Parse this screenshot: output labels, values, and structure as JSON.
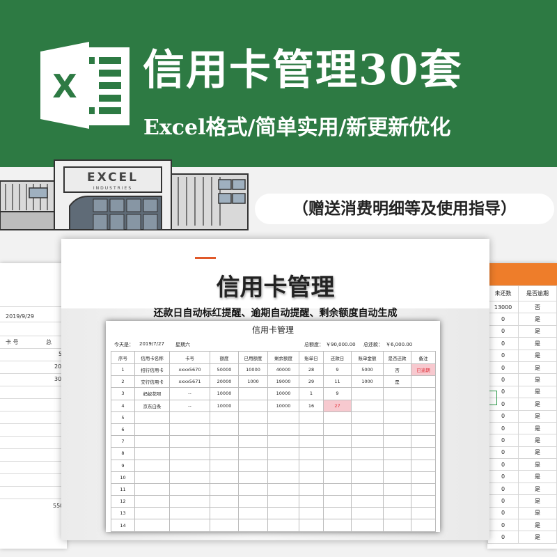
{
  "banner": {
    "title": "信用卡管理30套",
    "subtitle": "Excel格式/简单实用/新更新优化",
    "gift_note": "（赠送消费明细等及使用指导）",
    "logo_letter": "X",
    "building_sign": "EXCEL",
    "building_sign_sub": "INDUSTRIES"
  },
  "colors": {
    "banner_green": "#2d7a43",
    "accent_orange": "#ee7d2a",
    "overdue_pink": "#f7c9cf",
    "overdue_red": "#e0303a"
  },
  "left_sheet": {
    "date": "2019/9/29",
    "header": "卡  号",
    "header2": "总",
    "values": [
      "5",
      "20",
      "30"
    ],
    "total": "550"
  },
  "right_sheet": {
    "headers": [
      "未还数",
      "是否逾期"
    ],
    "rows": [
      [
        "13000",
        "否"
      ],
      [
        "0",
        "是"
      ],
      [
        "0",
        "是"
      ],
      [
        "0",
        "是"
      ],
      [
        "0",
        "是"
      ],
      [
        "0",
        "是"
      ],
      [
        "0",
        "是"
      ],
      [
        "0",
        "是"
      ],
      [
        "0",
        "是"
      ],
      [
        "0",
        "是"
      ],
      [
        "0",
        "是"
      ],
      [
        "0",
        "是"
      ],
      [
        "0",
        "是"
      ],
      [
        "0",
        "是"
      ],
      [
        "0",
        "是"
      ],
      [
        "0",
        "是"
      ],
      [
        "0",
        "是"
      ],
      [
        "0",
        "是"
      ],
      [
        "0",
        "是"
      ],
      [
        "0",
        "是"
      ]
    ]
  },
  "main_sheet": {
    "title": "信用卡管理",
    "subtitle": "还款日自动标红提醒、逾期自动提醒、剩余额度自动生成",
    "inner_title": "信用卡管理",
    "today_label": "今天是：",
    "today_date": "2019/7/27",
    "weekday": "星期六",
    "total_limit_label": "总额度：",
    "total_limit_value": "￥90,000.00",
    "total_repaid_label": "总还款：",
    "total_repaid_value": "￥6,000.00",
    "columns": [
      "序号",
      "信用卡名称",
      "卡号",
      "额度",
      "已用额度",
      "剩余额度",
      "账单日",
      "还款日",
      "账单金额",
      "是否还款",
      "备注"
    ],
    "rows": [
      [
        "1",
        "招行信用卡",
        "xxxx5670",
        "50000",
        "10000",
        "40000",
        "28",
        "9",
        "5000",
        "否",
        "已逾期"
      ],
      [
        "2",
        "交行信用卡",
        "xxxx5671",
        "20000",
        "1000",
        "19000",
        "29",
        "11",
        "1000",
        "是",
        ""
      ],
      [
        "3",
        "蚂蚁花呗",
        "--",
        "10000",
        "",
        "10000",
        "1",
        "9",
        "",
        "",
        ""
      ],
      [
        "4",
        "京东白条",
        "--",
        "10000",
        "",
        "10000",
        "16",
        "27",
        "",
        "",
        ""
      ],
      [
        "5",
        "",
        "",
        "",
        "",
        "",
        "",
        "",
        "",
        "",
        ""
      ],
      [
        "6",
        "",
        "",
        "",
        "",
        "",
        "",
        "",
        "",
        "",
        ""
      ],
      [
        "7",
        "",
        "",
        "",
        "",
        "",
        "",
        "",
        "",
        "",
        ""
      ],
      [
        "8",
        "",
        "",
        "",
        "",
        "",
        "",
        "",
        "",
        "",
        ""
      ],
      [
        "9",
        "",
        "",
        "",
        "",
        "",
        "",
        "",
        "",
        "",
        ""
      ],
      [
        "10",
        "",
        "",
        "",
        "",
        "",
        "",
        "",
        "",
        "",
        ""
      ],
      [
        "11",
        "",
        "",
        "",
        "",
        "",
        "",
        "",
        "",
        "",
        ""
      ],
      [
        "12",
        "",
        "",
        "",
        "",
        "",
        "",
        "",
        "",
        "",
        ""
      ],
      [
        "13",
        "",
        "",
        "",
        "",
        "",
        "",
        "",
        "",
        "",
        ""
      ],
      [
        "14",
        "",
        "",
        "",
        "",
        "",
        "",
        "",
        "",
        "",
        ""
      ]
    ],
    "highlight_pink": [
      [
        0,
        10
      ],
      [
        3,
        7
      ]
    ],
    "highlight_red": [
      [
        0,
        10
      ],
      [
        3,
        7
      ]
    ]
  }
}
